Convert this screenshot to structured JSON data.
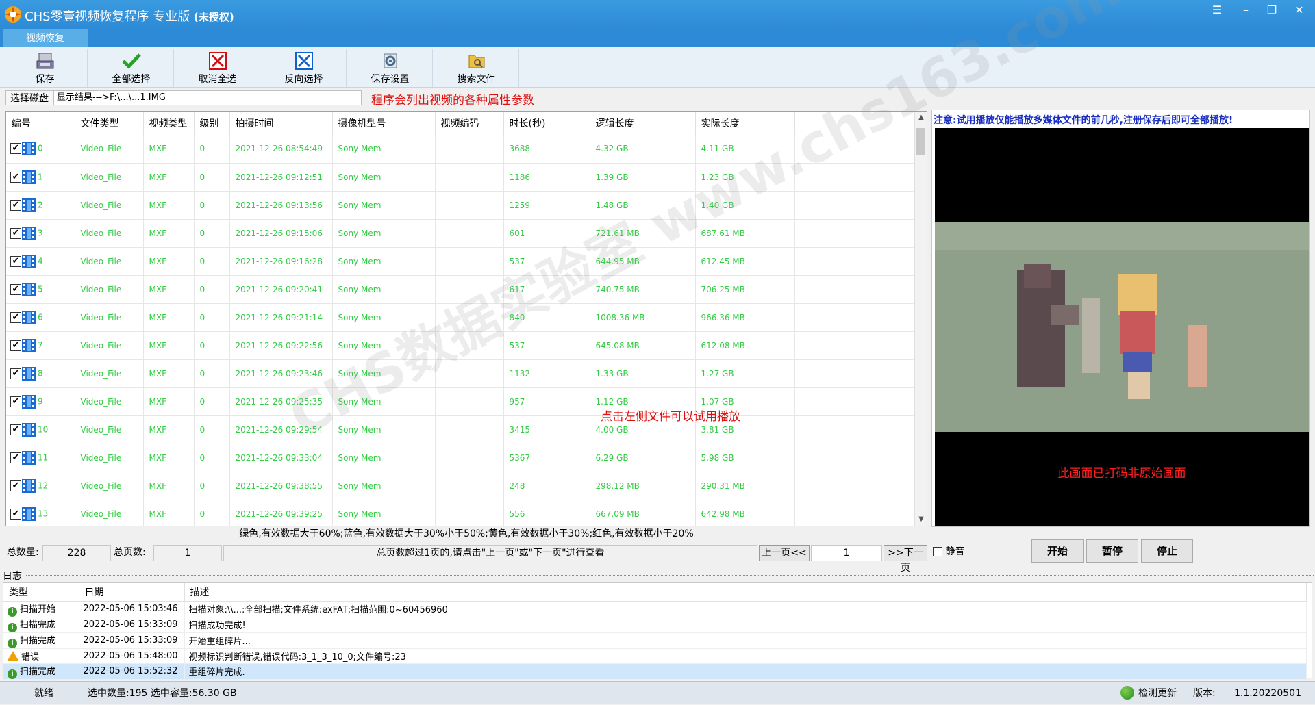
{
  "app": {
    "title": "CHS零壹视频恢复程序 专业版",
    "license": "(未授权)",
    "tab": "视频恢复"
  },
  "toolbar": {
    "save": "保存",
    "select_all": "全部选择",
    "deselect_all": "取消全选",
    "invert_selection": "反向选择",
    "save_settings": "保存设置",
    "search_files": "搜索文件"
  },
  "pathbar": {
    "select_disk": "选择磁盘",
    "path": "显示结果--->F:\\...\\...1.IMG",
    "note": "程序会列出视频的各种属性参数"
  },
  "grid": {
    "columns": [
      "编号",
      "文件类型",
      "视频类型",
      "级别",
      "拍摄时间",
      "摄像机型号",
      "视频编码",
      "时长(秒)",
      "逻辑长度",
      "实际长度"
    ],
    "rows": [
      {
        "id": "0",
        "type": "Video_File",
        "vtype": "MXF",
        "level": "0",
        "time": "2021-12-26 08:54:49",
        "camera": "Sony Mem",
        "codec": "",
        "duration": "3688",
        "logical": "4.32 GB",
        "actual": "4.11 GB"
      },
      {
        "id": "1",
        "type": "Video_File",
        "vtype": "MXF",
        "level": "0",
        "time": "2021-12-26 09:12:51",
        "camera": "Sony Mem",
        "codec": "",
        "duration": "1186",
        "logical": "1.39 GB",
        "actual": "1.23 GB"
      },
      {
        "id": "2",
        "type": "Video_File",
        "vtype": "MXF",
        "level": "0",
        "time": "2021-12-26 09:13:56",
        "camera": "Sony Mem",
        "codec": "",
        "duration": "1259",
        "logical": "1.48 GB",
        "actual": "1.40 GB"
      },
      {
        "id": "3",
        "type": "Video_File",
        "vtype": "MXF",
        "level": "0",
        "time": "2021-12-26 09:15:06",
        "camera": "Sony Mem",
        "codec": "",
        "duration": "601",
        "logical": "721.61 MB",
        "actual": "687.61 MB"
      },
      {
        "id": "4",
        "type": "Video_File",
        "vtype": "MXF",
        "level": "0",
        "time": "2021-12-26 09:16:28",
        "camera": "Sony Mem",
        "codec": "",
        "duration": "537",
        "logical": "644.95 MB",
        "actual": "612.45 MB"
      },
      {
        "id": "5",
        "type": "Video_File",
        "vtype": "MXF",
        "level": "0",
        "time": "2021-12-26 09:20:41",
        "camera": "Sony Mem",
        "codec": "",
        "duration": "617",
        "logical": "740.75 MB",
        "actual": "706.25 MB"
      },
      {
        "id": "6",
        "type": "Video_File",
        "vtype": "MXF",
        "level": "0",
        "time": "2021-12-26 09:21:14",
        "camera": "Sony Mem",
        "codec": "",
        "duration": "840",
        "logical": "1008.36 MB",
        "actual": "966.36 MB"
      },
      {
        "id": "7",
        "type": "Video_File",
        "vtype": "MXF",
        "level": "0",
        "time": "2021-12-26 09:22:56",
        "camera": "Sony Mem",
        "codec": "",
        "duration": "537",
        "logical": "645.08 MB",
        "actual": "612.08 MB"
      },
      {
        "id": "8",
        "type": "Video_File",
        "vtype": "MXF",
        "level": "0",
        "time": "2021-12-26 09:23:46",
        "camera": "Sony Mem",
        "codec": "",
        "duration": "1132",
        "logical": "1.33 GB",
        "actual": "1.27 GB"
      },
      {
        "id": "9",
        "type": "Video_File",
        "vtype": "MXF",
        "level": "0",
        "time": "2021-12-26 09:25:35",
        "camera": "Sony Mem",
        "codec": "",
        "duration": "957",
        "logical": "1.12 GB",
        "actual": "1.07 GB"
      },
      {
        "id": "10",
        "type": "Video_File",
        "vtype": "MXF",
        "level": "0",
        "time": "2021-12-26 09:29:54",
        "camera": "Sony Mem",
        "codec": "",
        "duration": "3415",
        "logical": "4.00 GB",
        "actual": "3.81 GB"
      },
      {
        "id": "11",
        "type": "Video_File",
        "vtype": "MXF",
        "level": "0",
        "time": "2021-12-26 09:33:04",
        "camera": "Sony Mem",
        "codec": "",
        "duration": "5367",
        "logical": "6.29 GB",
        "actual": "5.98 GB"
      },
      {
        "id": "12",
        "type": "Video_File",
        "vtype": "MXF",
        "level": "0",
        "time": "2021-12-26 09:38:55",
        "camera": "Sony Mem",
        "codec": "",
        "duration": "248",
        "logical": "298.12 MB",
        "actual": "290.31 MB"
      },
      {
        "id": "13",
        "type": "Video_File",
        "vtype": "MXF",
        "level": "0",
        "time": "2021-12-26 09:39:25",
        "camera": "Sony Mem",
        "codec": "",
        "duration": "556",
        "logical": "667.09 MB",
        "actual": "642.98 MB"
      }
    ]
  },
  "legend": "绿色,有效数据大于60%;蓝色,有效数据大于30%小于50%;黄色,有效数据小于30%;红色,有效数据小于20%",
  "stats": {
    "total_label": "总数量:",
    "total": "228",
    "pages_label": "总页数:",
    "pages": "1",
    "hint": "总页数超过1页的,请点击\"上一页\"或\"下一页\"进行查看",
    "prev": "上一页<<",
    "page": "1",
    "next": ">>下一页"
  },
  "preview": {
    "notice": "注意:试用播放仅能播放多媒体文件的前几秒,注册保存后即可全部播放!",
    "caption": "此画面已打码非原始画面",
    "mute": "静音",
    "start": "开始",
    "pause": "暂停",
    "stop": "停止"
  },
  "overlay_hint": "点击左侧文件可以试用播放",
  "watermark": "CHS数据实验室  www.chs163.com",
  "log": {
    "label": "日志",
    "columns": [
      "类型",
      "日期",
      "描述"
    ],
    "rows": [
      {
        "icon": "info",
        "type": "扫描开始",
        "date": "2022-05-06 15:03:46",
        "desc": "扫描对象:\\\\...:全部扫描;文件系统:exFAT;扫描范围:0~60456960"
      },
      {
        "icon": "info",
        "type": "扫描完成",
        "date": "2022-05-06 15:33:09",
        "desc": "扫描成功完成!"
      },
      {
        "icon": "info",
        "type": "扫描完成",
        "date": "2022-05-06 15:33:09",
        "desc": "开始重组碎片..."
      },
      {
        "icon": "warn",
        "type": "错误",
        "date": "2022-05-06 15:48:00",
        "desc": "视频标识判断错误,错误代码:3_1_3_10_0;文件编号:23"
      },
      {
        "icon": "info",
        "type": "扫描完成",
        "date": "2022-05-06 15:52:32",
        "desc": "重组碎片完成."
      }
    ]
  },
  "status": {
    "ready": "就绪",
    "selection": "选中数量:195 选中容量:56.30 GB",
    "update": "检测更新",
    "version_label": "版本:",
    "version": "1.1.20220501"
  },
  "colors": {
    "titlebar": "#2d8ad6",
    "row_text": "#33cc44",
    "note_red": "#e01010",
    "notice_blue": "#1a2fc0"
  }
}
